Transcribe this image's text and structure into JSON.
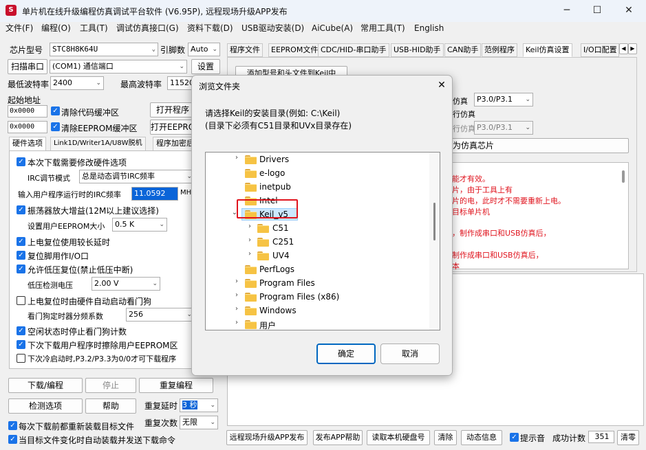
{
  "window": {
    "title": "单片机在线升级编程仿真调试平台软件 (V6.95P), 远程现场升级APP发布",
    "logo_text": "S",
    "min_glyph": "─",
    "max_glyph": "☐",
    "close_glyph": "✕"
  },
  "menu": [
    "文件(F)",
    "编程(O)",
    "工具(T)",
    "调试仿真接口(G)",
    "资料下载(D)",
    "USB驱动安装(D)",
    "AiCube(A)",
    "常用工具(T)",
    "English"
  ],
  "left": {
    "chip_label": "芯片型号",
    "chip_value": "STC8H8K64U",
    "pins_label": "引脚数",
    "pins_value": "Auto",
    "scan_button": "扫描串口",
    "port_value": "(COM1) 通信端口",
    "settings_button": "设置",
    "min_baud_label": "最低波特率",
    "min_baud_value": "2400",
    "max_baud_label": "最高波特率",
    "max_baud_value": "115200",
    "start_addr_label": "起始地址",
    "addr1": "0x0000",
    "clear_code_label": "清除代码缓冲区",
    "open_program_button": "打开程序",
    "addr2": "0x0000",
    "clear_eeprom_label": "清除EEPROM缓冲区",
    "open_eeprom_button": "打开EEPRO",
    "tabs": [
      "硬件选项",
      "Link1D/Writer1A/U8W脱机",
      "程序加密后"
    ],
    "options": {
      "modify_hw": "本次下载需要修改硬件选项",
      "irc_mode_label": "IRC调节模式",
      "irc_mode_value": "总是动态调节IRC频率",
      "irc_freq_label": "输入用户程序运行时的IRC频率",
      "irc_freq_value": "11.0592",
      "irc_freq_unit": "MHz",
      "osc_gain": "振荡器放大增益(12M以上建议选择)",
      "eeprom_size_label": "设置用户EEPROM大小",
      "eeprom_size_value": "0.5 K",
      "long_reset": "上电复位使用较长延时",
      "reset_io": "复位脚用作I/O口",
      "lvr": "允许低压复位(禁止低压中断)",
      "lvd_label": "低压检测电压",
      "lvd_value": "2.00 V",
      "wdt_auto": "上电复位时由硬件自动启动看门狗",
      "wdt_div_label": "看门狗定时器分频系数",
      "wdt_div_value": "256",
      "wdt_idle": "空闲状态时停止看门狗计数",
      "erase_eeprom": "下次下载用户程序时擦除用户EEPROM区",
      "cold_boot": "下次冷启动时,P3.2/P3.3为0/0才可下载程序"
    },
    "download_button": "下载/编程",
    "stop_button": "停止",
    "reprogram_button": "重复编程",
    "detect_button": "检测选项",
    "help_button": "帮助",
    "repeat_delay_label": "重复延时",
    "repeat_delay_value": "3 秒",
    "repeat_count_label": "重复次数",
    "repeat_count_value": "无限",
    "reload_label": "每次下载前都重新装载目标文件",
    "auto_send_label": "当目标文件变化时自动装载并发送下载命令"
  },
  "right": {
    "tabs": [
      "程序文件",
      "EEPROM文件",
      "CDC/HID-串口助手",
      "USB-HID助手",
      "CAN助手",
      "范例程序",
      "Keil仿真设置",
      "I/O口配置"
    ],
    "add_model_button": "添加型号和头文件到Keil中",
    "emu_label1": "仿真",
    "emu_value1": "P3.0/P3.1",
    "emu_label2": "行仿真",
    "emu_label3": "行仿真",
    "emu_value3": "P3.0/P3.1",
    "set_chip_button": "为仿真芯片",
    "info_lines": [
      "能才有效。",
      "片，由于工具上有",
      "片的电，此时才不需要重新上电。",
      "目标单片机",
      "，制作成串口和USB仿真后，",
      "",
      "制作成串口和USB仿真后，",
      "本"
    ],
    "bottom_buttons": {
      "remote_publish": "远程现场升级APP发布",
      "publish_help": "发布APP帮助",
      "read_disk": "读取本机硬盘号",
      "clear": "清除",
      "dynamic_info": "动态信息"
    },
    "beep_label": "提示音",
    "success_label": "成功计数",
    "success_count": "351",
    "reset_count_button": "清零"
  },
  "dialog": {
    "title": "浏览文件夹",
    "close_glyph": "✕",
    "prompt_line1": "请选择Keil的安装目录(例如: C:\\Keil)",
    "prompt_line2": "(目录下必须有C51目录和UVx目录存在)",
    "tree": [
      {
        "name": "Drivers",
        "expander": "›"
      },
      {
        "name": "e-logo",
        "expander": ""
      },
      {
        "name": "inetpub",
        "expander": ""
      },
      {
        "name": "Intel",
        "expander": ""
      },
      {
        "name": "Keil_v5",
        "expander": "⌄"
      },
      {
        "name": "C51",
        "expander": "›"
      },
      {
        "name": "C251",
        "expander": "›"
      },
      {
        "name": "UV4",
        "expander": "›"
      },
      {
        "name": "PerfLogs",
        "expander": ""
      },
      {
        "name": "Program Files",
        "expander": "›"
      },
      {
        "name": "Program Files (x86)",
        "expander": "›"
      },
      {
        "name": "Windows",
        "expander": "›"
      },
      {
        "name": "用户",
        "expander": "›"
      }
    ],
    "ok_button": "确定",
    "cancel_button": "取消",
    "highlight_color": "#e0141e"
  }
}
